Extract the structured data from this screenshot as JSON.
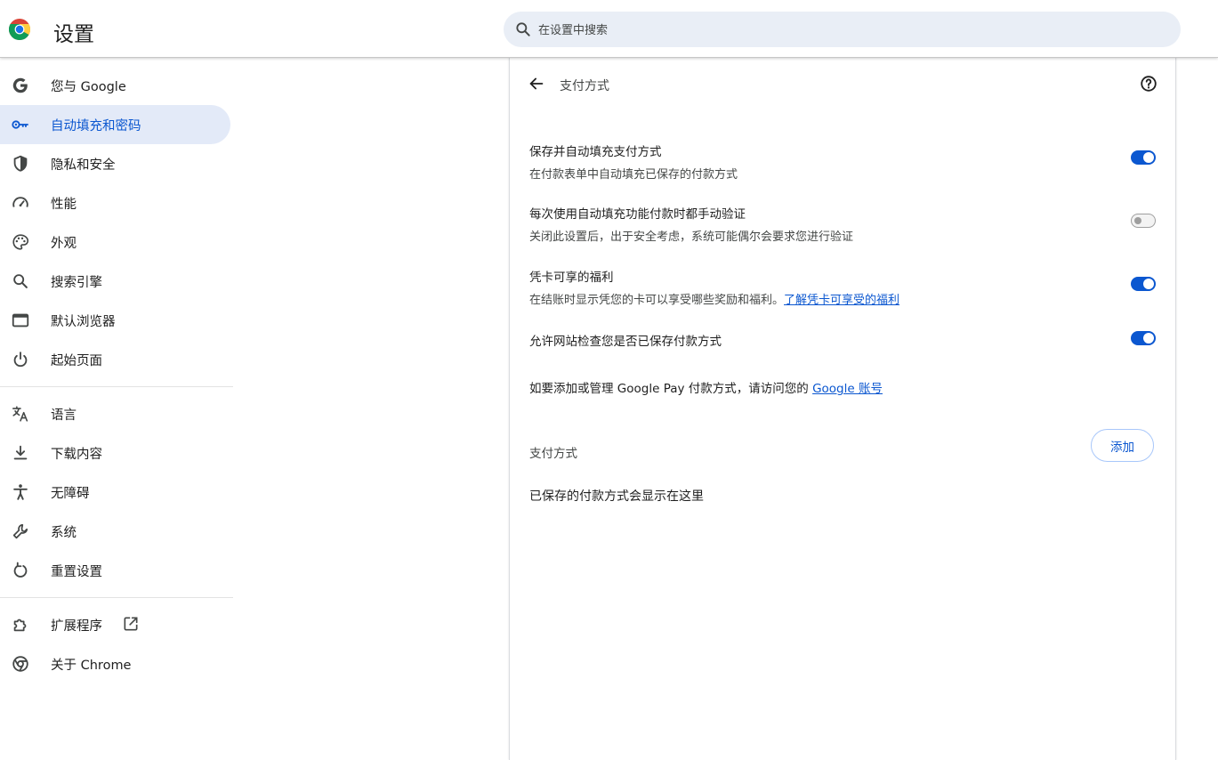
{
  "header": {
    "title": "设置",
    "search_placeholder": "在设置中搜索"
  },
  "sidebar": {
    "group1": [
      {
        "label": "您与 Google",
        "icon": "google-g-icon"
      },
      {
        "label": "自动填充和密码",
        "icon": "key-icon",
        "active": true
      },
      {
        "label": "隐私和安全",
        "icon": "shield-icon"
      },
      {
        "label": "性能",
        "icon": "speedometer-icon"
      },
      {
        "label": "外观",
        "icon": "palette-icon"
      },
      {
        "label": "搜索引擎",
        "icon": "search-icon"
      },
      {
        "label": "默认浏览器",
        "icon": "browser-window-icon"
      },
      {
        "label": "起始页面",
        "icon": "power-icon"
      }
    ],
    "group2": [
      {
        "label": "语言",
        "icon": "translate-icon"
      },
      {
        "label": "下载内容",
        "icon": "download-icon"
      },
      {
        "label": "无障碍",
        "icon": "accessibility-icon"
      },
      {
        "label": "系统",
        "icon": "wrench-icon"
      },
      {
        "label": "重置设置",
        "icon": "reset-icon"
      }
    ],
    "group3": [
      {
        "label": "扩展程序",
        "icon": "puzzle-icon"
      },
      {
        "label": "关于 Chrome",
        "icon": "chrome-icon"
      }
    ]
  },
  "panel": {
    "title": "支付方式",
    "settings": [
      {
        "title": "保存并自动填充支付方式",
        "subtitle": "在付款表单中自动填充已保存的付款方式",
        "enabled": true
      },
      {
        "title": "每次使用自动填充功能付款时都手动验证",
        "subtitle": "关闭此设置后，出于安全考虑，系统可能偶尔会要求您进行验证",
        "enabled": false
      },
      {
        "title": "凭卡可享的福利",
        "subtitle": "在结账时显示凭您的卡可以享受哪些奖励和福利。",
        "link": "了解凭卡可享受的福利",
        "enabled": true
      },
      {
        "title": "允许网站检查您是否已保存付款方式",
        "enabled": true
      }
    ],
    "google_pay_text": "如要添加或管理 Google Pay 付款方式，请访问您的",
    "google_pay_link": "Google 账号",
    "section_label": "支付方式",
    "add_button": "添加",
    "empty_message": "已保存的付款方式会显示在这里"
  },
  "colors": {
    "accent": "#0b57d0",
    "active_nav_bg": "#e3eaf8",
    "search_bg": "#e9eef6"
  }
}
